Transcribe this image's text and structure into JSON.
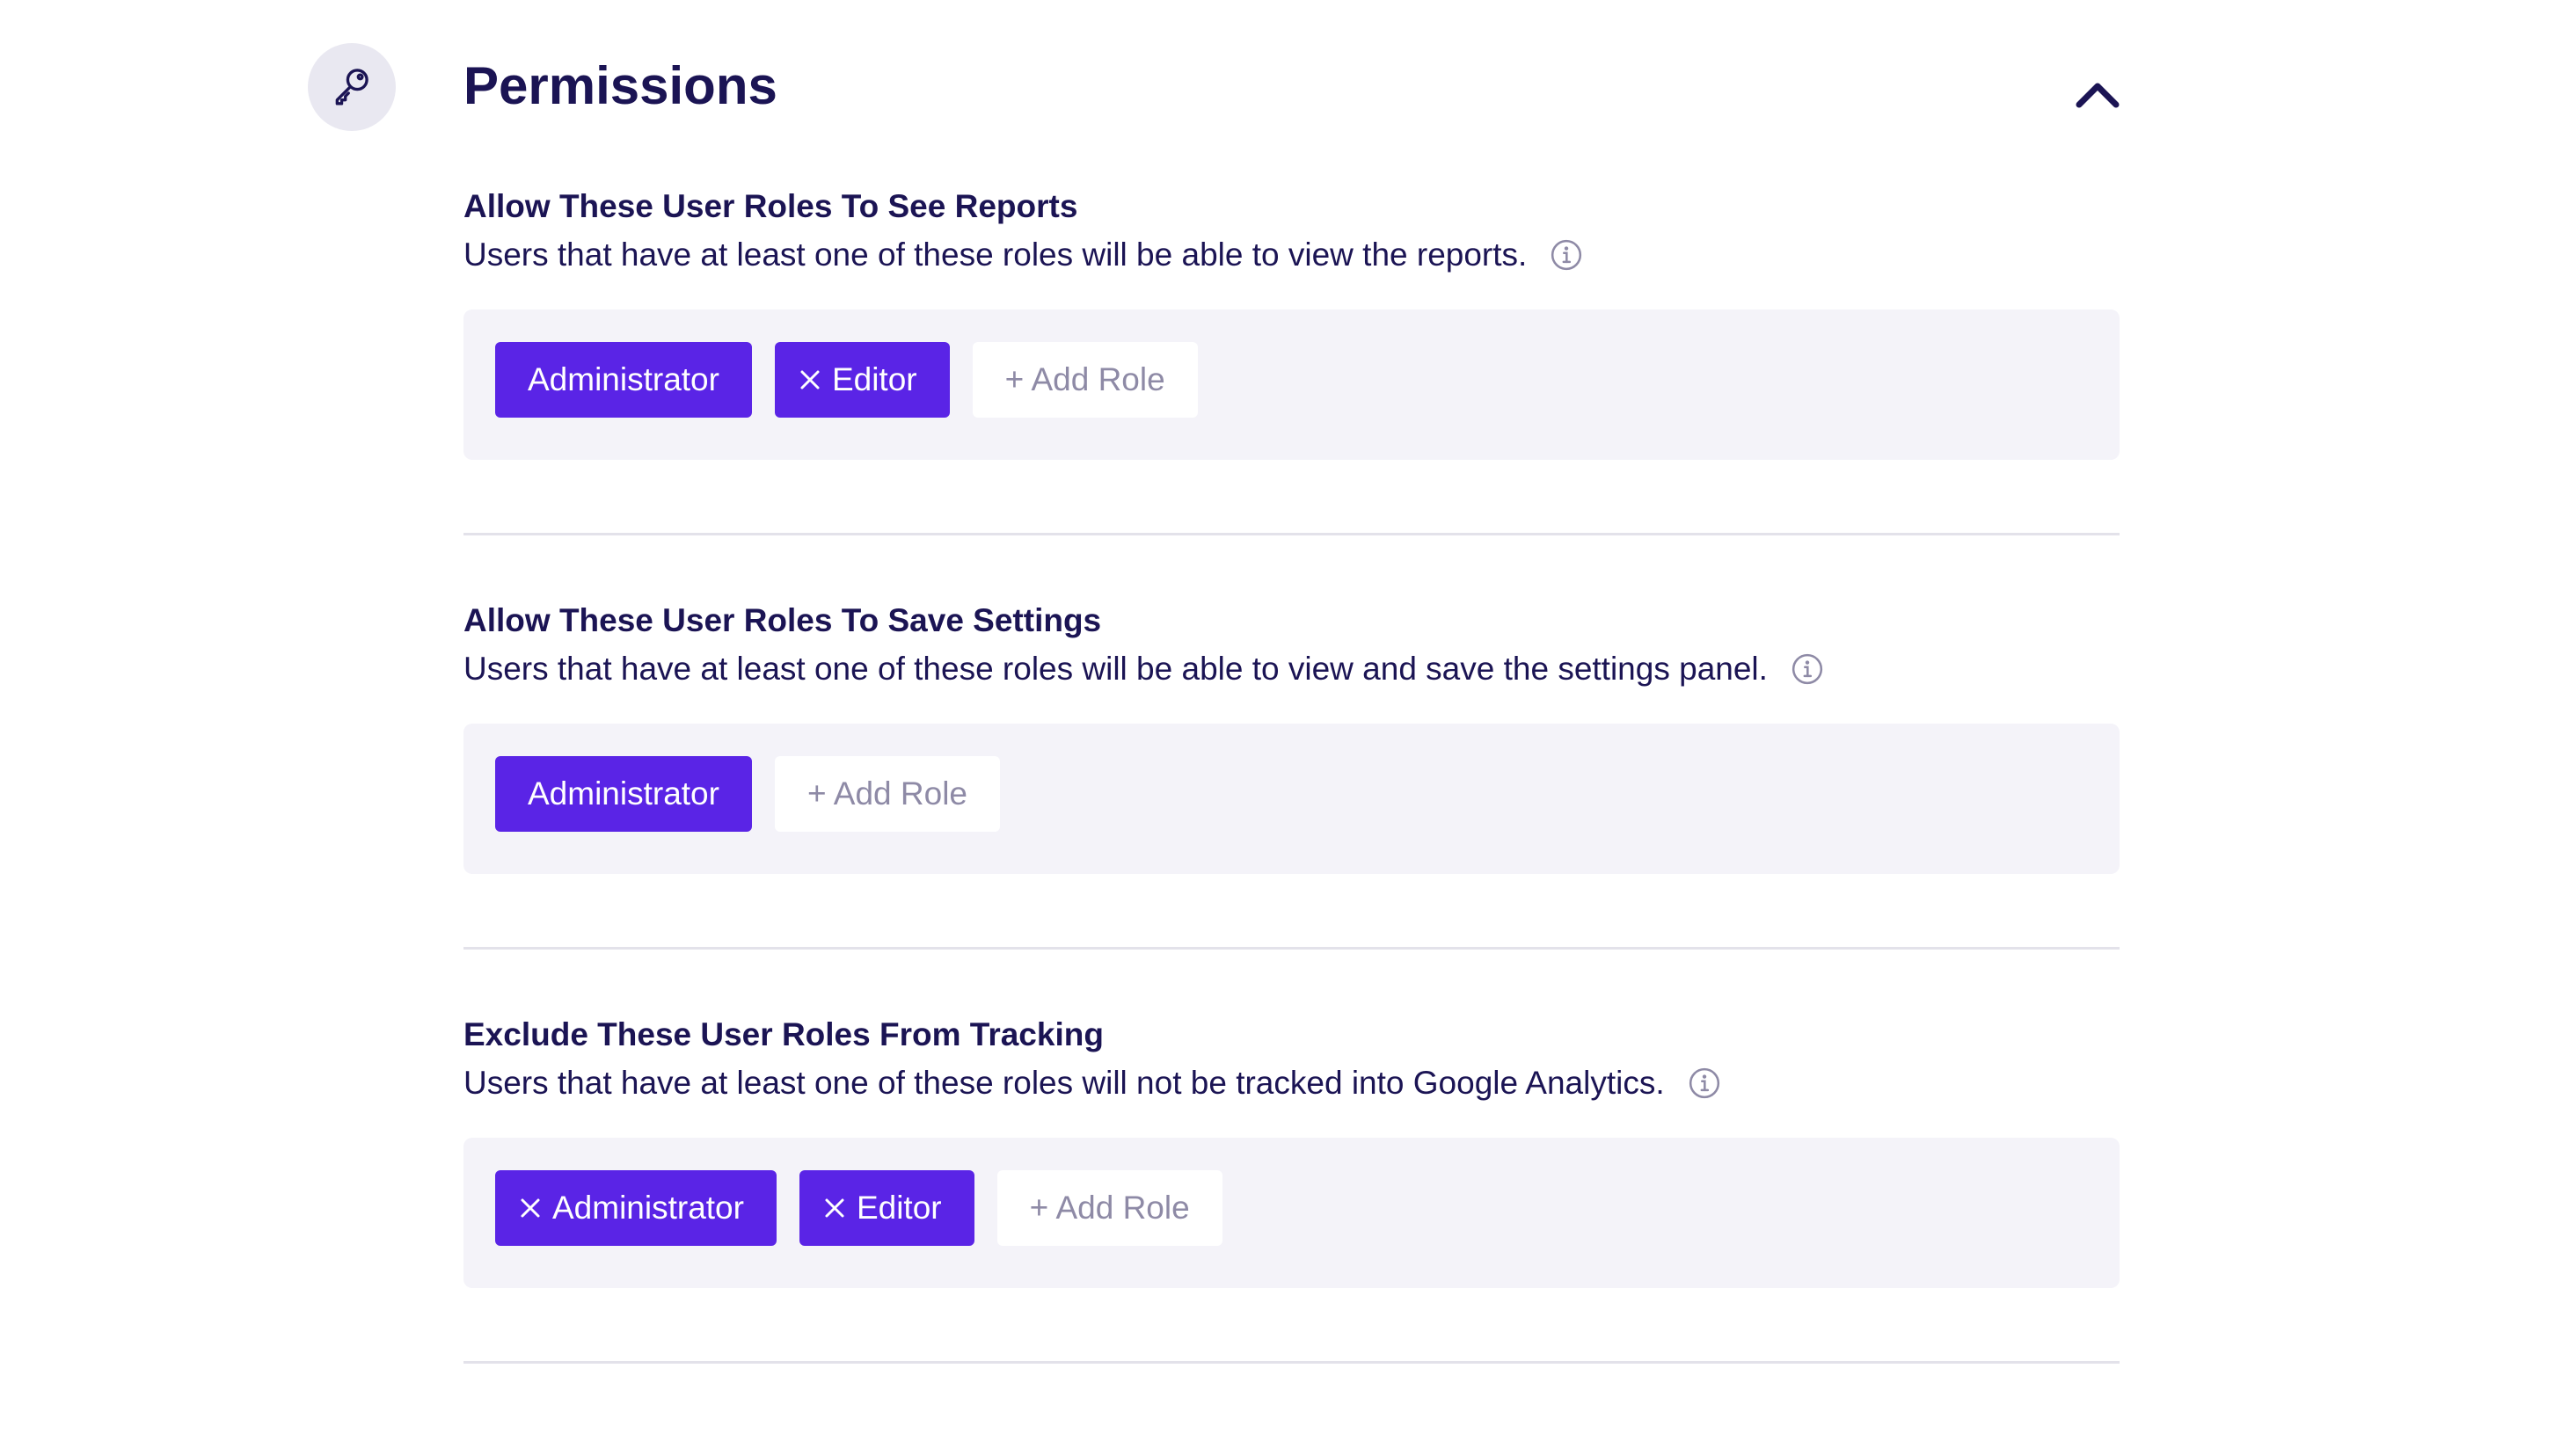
{
  "panel": {
    "title": "Permissions",
    "icon": "key-icon",
    "collapse_icon": "chevron-up-icon"
  },
  "sections": [
    {
      "heading": "Allow These User Roles To See Reports",
      "description": "Users that have at least one of these roles will be able to view the reports.",
      "roles": [
        {
          "label": "Administrator",
          "removable": false
        },
        {
          "label": "Editor",
          "removable": true
        }
      ],
      "add_label": "+ Add Role"
    },
    {
      "heading": "Allow These User Roles To Save Settings",
      "description": "Users that have at least one of these roles will be able to view and save the settings panel.",
      "roles": [
        {
          "label": "Administrator",
          "removable": false
        }
      ],
      "add_label": "+ Add Role"
    },
    {
      "heading": "Exclude These User Roles From Tracking",
      "description": "Users that have at least one of these roles will not be tracked into Google Analytics.",
      "roles": [
        {
          "label": "Administrator",
          "removable": true
        },
        {
          "label": "Editor",
          "removable": true
        }
      ],
      "add_label": "+ Add Role"
    }
  ],
  "colors": {
    "accent": "#5a24e6",
    "heading": "#1b1454",
    "box_bg": "#f4f3f9",
    "muted": "#8e8aa6",
    "divider": "#e3e2ea"
  }
}
